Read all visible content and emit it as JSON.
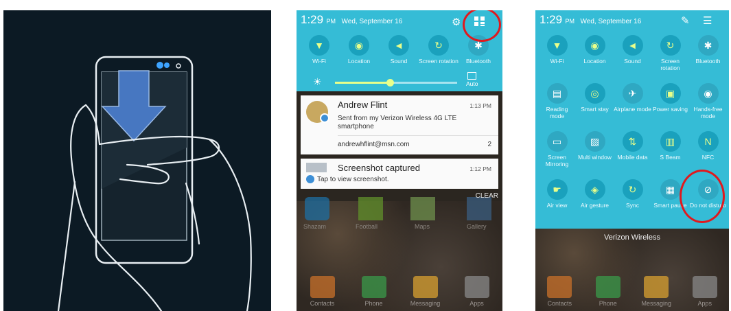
{
  "panel2": {
    "status": {
      "time": "1:29",
      "ampm": "PM",
      "date": "Wed, September 16"
    },
    "toggles": [
      {
        "label": "Wi-Fi",
        "icon": "wifi-icon",
        "glyph": "▼",
        "on": true
      },
      {
        "label": "Location",
        "icon": "location-icon",
        "glyph": "◉",
        "on": true
      },
      {
        "label": "Sound",
        "icon": "sound-icon",
        "glyph": "◄",
        "on": true
      },
      {
        "label": "Screen rotation",
        "icon": "rotation-icon",
        "glyph": "↻",
        "on": true
      },
      {
        "label": "Bluetooth",
        "icon": "bluetooth-icon",
        "glyph": "✱",
        "on": false
      }
    ],
    "brightness": {
      "auto_label": "Auto",
      "level": 0.45
    },
    "notifications": [
      {
        "title": "Andrew Flint",
        "time": "1:13 PM",
        "body": "Sent from my Verizon Wireless 4G LTE smartphone",
        "sender": "andrewhflint@msn.com",
        "count": "2"
      },
      {
        "title": "Screenshot captured",
        "time": "1:12 PM",
        "body": "Tap to view screenshot."
      }
    ],
    "clear_label": "CLEAR",
    "home_apps": [
      "Shazam",
      "Football",
      "Maps",
      "Gallery"
    ],
    "dock": [
      "Contacts",
      "Phone",
      "Messaging",
      "Apps"
    ]
  },
  "panel3": {
    "status": {
      "time": "1:29",
      "ampm": "PM",
      "date": "Wed, September 16"
    },
    "tiles": [
      {
        "label": "Wi-Fi",
        "icon": "wifi-icon",
        "glyph": "▼",
        "on": true
      },
      {
        "label": "Location",
        "icon": "location-icon",
        "glyph": "◉",
        "on": true
      },
      {
        "label": "Sound",
        "icon": "sound-icon",
        "glyph": "◄",
        "on": true
      },
      {
        "label": "Screen rotation",
        "icon": "rotation-icon",
        "glyph": "↻",
        "on": true
      },
      {
        "label": "Bluetooth",
        "icon": "bluetooth-icon",
        "glyph": "✱",
        "on": false
      },
      {
        "label": "Reading mode",
        "icon": "reading-mode-icon",
        "glyph": "▤",
        "on": false
      },
      {
        "label": "Smart stay",
        "icon": "smart-stay-icon",
        "glyph": "◎",
        "on": true
      },
      {
        "label": "Airplane mode",
        "icon": "airplane-icon",
        "glyph": "✈",
        "on": false
      },
      {
        "label": "Power saving",
        "icon": "power-saving-icon",
        "glyph": "▣",
        "on": true
      },
      {
        "label": "Hands-free mode",
        "icon": "hands-free-icon",
        "glyph": "◉",
        "on": false
      },
      {
        "label": "Screen Mirroring",
        "icon": "screen-mirroring-icon",
        "glyph": "▭",
        "on": false
      },
      {
        "label": "Multi window",
        "icon": "multi-window-icon",
        "glyph": "▨",
        "on": false
      },
      {
        "label": "Mobile data",
        "icon": "mobile-data-icon",
        "glyph": "⇅",
        "on": true
      },
      {
        "label": "S Beam",
        "icon": "s-beam-icon",
        "glyph": "▥",
        "on": true
      },
      {
        "label": "NFC",
        "icon": "nfc-icon",
        "glyph": "N",
        "on": true
      },
      {
        "label": "Air view",
        "icon": "air-view-icon",
        "glyph": "☛",
        "on": true
      },
      {
        "label": "Air gesture",
        "icon": "air-gesture-icon",
        "glyph": "◈",
        "on": true
      },
      {
        "label": "Sync",
        "icon": "sync-icon",
        "glyph": "↻",
        "on": true
      },
      {
        "label": "Smart pause",
        "icon": "smart-pause-icon",
        "glyph": "▦",
        "on": false
      },
      {
        "label": "Do not disturb",
        "icon": "do-not-disturb-icon",
        "glyph": "⊘",
        "on": false
      }
    ],
    "carrier": "Verizon Wireless",
    "dock": [
      "Contacts",
      "Phone",
      "Messaging",
      "Apps"
    ]
  }
}
